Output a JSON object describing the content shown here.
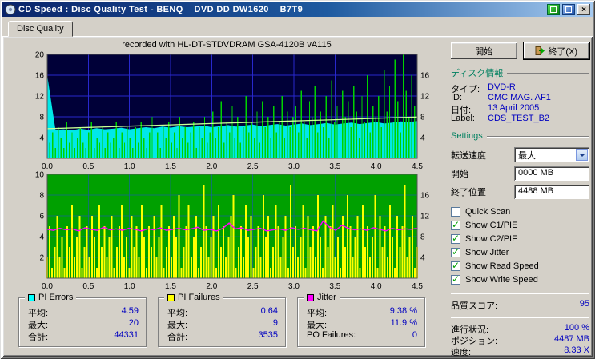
{
  "colors": {
    "window_bg": "#D4D0C8",
    "titlebar_start": "#0A246A",
    "titlebar_end": "#A6CAF0",
    "section_title": "#008060",
    "value_blue": "#0000C0",
    "check_green": "#00A000"
  },
  "window": {
    "title": "CD Speed : Disc Quality Test - BENQ    DVD DD DW1620    B7T9",
    "buttons": {
      "close": "×"
    }
  },
  "tab": {
    "label": "Disc Quality"
  },
  "graph_header": "recorded with HL-DT-STDVDRAM GSA-4120B vA115",
  "actions": {
    "start": "開始",
    "exit": "終了(X)"
  },
  "disc_info": {
    "title": "ディスク情報",
    "rows": [
      {
        "label": "タイプ:",
        "value": "DVD-R"
      },
      {
        "label": "ID:",
        "value": "CMC MAG. AF1"
      },
      {
        "label": "日付:",
        "value": "13 April 2005"
      },
      {
        "label": "Label:",
        "value": "CDS_TEST_B2"
      }
    ]
  },
  "settings": {
    "title": "Settings",
    "speed_label": "転送速度",
    "speed_value": "最大",
    "start_label": "開始",
    "start_value": "0000 MB",
    "end_label": "終了位置",
    "end_value": "4488 MB",
    "checkboxes": [
      {
        "label": "Quick Scan",
        "checked": false
      },
      {
        "label": "Show C1/PIE",
        "checked": true
      },
      {
        "label": "Show C2/PIF",
        "checked": true
      },
      {
        "label": "Show Jitter",
        "checked": true
      },
      {
        "label": "Show Read Speed",
        "checked": true
      },
      {
        "label": "Show Write Speed",
        "checked": true
      }
    ]
  },
  "quality": {
    "label": "品質スコア:",
    "value": "95"
  },
  "status": {
    "rows": [
      {
        "label": "進行状況:",
        "value": "100 %"
      },
      {
        "label": "ポジション:",
        "value": "4487 MB"
      },
      {
        "label": "速度:",
        "value": "8.33 X"
      }
    ]
  },
  "stats": {
    "boxes": [
      {
        "title": "PI Errors",
        "color": "#00FFFF",
        "rows": [
          {
            "label": "平均:",
            "value": "4.59"
          },
          {
            "label": "最大:",
            "value": "20"
          },
          {
            "label": "合計:",
            "value": "44331"
          }
        ]
      },
      {
        "title": "PI Failures",
        "color": "#FFFF00",
        "rows": [
          {
            "label": "平均:",
            "value": "0.64"
          },
          {
            "label": "最大:",
            "value": "9"
          },
          {
            "label": "合計:",
            "value": "3535"
          }
        ]
      },
      {
        "title": "Jitter",
        "color": "#FF00FF",
        "rows": [
          {
            "label": "平均:",
            "value": "9.38 %"
          },
          {
            "label": "最大:",
            "value": "11.9 %"
          },
          {
            "label": "PO Failures:",
            "value": "0"
          }
        ]
      }
    ]
  },
  "chart_data": [
    {
      "type": "area",
      "name": "pi-errors-graph",
      "bg": "#000038",
      "grid": "#2A2AD4",
      "grid_opacity": 0.95,
      "x_range": [
        0,
        4.5
      ],
      "x_ticks": [
        "0.0",
        "0.5",
        "1.0",
        "1.5",
        "2.0",
        "2.5",
        "3.0",
        "3.5",
        "4.0",
        "4.5"
      ],
      "left_max": 20,
      "left_ticks": [
        20,
        16,
        12,
        8,
        4
      ],
      "right_max": 20,
      "right_ticks": [
        16,
        12,
        8,
        4
      ],
      "series": [
        {
          "name": "read-speed-area",
          "draw": "area",
          "color": "#00E8E8",
          "max": 20,
          "values": [
            16,
            5.5,
            5.6,
            5.4,
            5.7,
            5.5,
            5.8,
            5.6,
            5.7,
            5.9,
            5.6,
            5.8,
            6.0,
            5.8,
            6.1,
            5.9,
            6.2,
            6.0,
            6.1,
            6.3,
            6.0,
            6.2,
            6.4,
            6.1,
            6.3,
            6.5,
            6.2,
            6.4,
            6.6,
            6.3,
            6.5,
            6.7,
            6.4,
            6.6,
            6.8,
            6.5,
            6.7,
            6.9,
            6.6,
            6.8,
            7.0,
            6.7,
            6.9,
            7.1,
            7.0,
            7.2
          ]
        },
        {
          "name": "pi-errors-spikes",
          "draw": "spikes",
          "color": "#00D200",
          "max": 20,
          "width": 1.4,
          "values": [
            16,
            3,
            5,
            2,
            6,
            4,
            2,
            7,
            3,
            5,
            2,
            4,
            6,
            3,
            2,
            5,
            7,
            2,
            4,
            3,
            6,
            2,
            5,
            3,
            4,
            7,
            2,
            5,
            3,
            6,
            4,
            2,
            6,
            3,
            7,
            4,
            2,
            5,
            8,
            3,
            5,
            2,
            6,
            4,
            7,
            3,
            5,
            2,
            8,
            4,
            6,
            3,
            5,
            7,
            2,
            6,
            4,
            8,
            3,
            5,
            9,
            4,
            6,
            11,
            3,
            7,
            5,
            10,
            4,
            8,
            3,
            6,
            12,
            5,
            7,
            4,
            9,
            3,
            11,
            6,
            8,
            4,
            10,
            5,
            7,
            12,
            4,
            9,
            6,
            8,
            10,
            5,
            13,
            7,
            4,
            11,
            8,
            14,
            5,
            9,
            6,
            12,
            4,
            15,
            7,
            10,
            5,
            13,
            8,
            11,
            6,
            14,
            9,
            4,
            12,
            7,
            16,
            5,
            10,
            8,
            12,
            6,
            17,
            9,
            14,
            7,
            19,
            11,
            5,
            20,
            13,
            8,
            16,
            10,
            12
          ]
        },
        {
          "name": "write-speed-line",
          "draw": "line",
          "color": "#C8FF96",
          "max": 20,
          "width": 1.3,
          "values": [
            5.7,
            5.95,
            6.2,
            6.45,
            6.7,
            6.95,
            7.2,
            7.45,
            7.7,
            7.95
          ]
        }
      ]
    },
    {
      "type": "bar",
      "name": "pi-failures-jitter-graph",
      "bg": "#00A000",
      "grid": "#1E50C8",
      "grid_opacity": 0.55,
      "x_range": [
        0,
        4.5
      ],
      "x_ticks": [
        "0.0",
        "0.5",
        "1.0",
        "1.5",
        "2.0",
        "2.5",
        "3.0",
        "3.5",
        "4.0",
        "4.5"
      ],
      "left_max": 10,
      "left_ticks": [
        10,
        8,
        6,
        4,
        2
      ],
      "right_max": 20,
      "right_ticks": [
        16,
        12,
        8,
        4
      ],
      "series": [
        {
          "name": "pi-failures-spikes",
          "draw": "spikes",
          "color": "#FFFF00",
          "max": 10,
          "width": 2,
          "values": [
            2,
            5,
            1,
            3,
            6,
            2,
            4,
            1,
            5,
            3,
            7,
            2,
            4,
            6,
            1,
            3,
            5,
            2,
            6,
            4,
            1,
            7,
            3,
            5,
            2,
            4,
            6,
            1,
            3,
            5,
            7,
            2,
            4,
            1,
            6,
            3,
            5,
            2,
            7,
            4,
            1,
            5,
            3,
            6,
            2,
            4,
            7,
            1,
            3,
            5,
            2,
            6,
            4,
            8,
            1,
            3,
            5,
            7,
            2,
            4,
            6,
            1,
            3,
            9,
            5,
            2,
            4,
            6,
            1,
            7,
            3,
            5,
            2,
            4,
            6,
            8,
            1,
            3,
            5,
            2,
            7,
            4,
            6,
            1,
            3,
            5,
            2,
            8,
            4,
            6,
            1,
            3,
            7,
            5,
            2,
            4,
            6,
            1,
            9,
            3,
            5,
            2,
            4,
            7,
            1,
            6,
            3,
            5,
            2,
            8,
            4,
            1,
            6,
            3,
            5,
            7,
            2,
            4,
            1,
            6,
            3,
            8,
            5,
            2,
            4,
            6,
            1,
            7,
            3,
            5,
            2,
            4,
            8,
            1,
            6,
            3,
            5,
            2,
            7,
            4,
            1,
            6,
            3,
            5,
            9,
            2,
            4,
            6,
            1,
            3
          ]
        },
        {
          "name": "jitter-line",
          "draw": "line",
          "color": "#FF00FF",
          "max": 20,
          "width": 1.4,
          "values": [
            9.4,
            9.2,
            9.6,
            9.3,
            9.5,
            9.1,
            9.7,
            9.4,
            9.2,
            9.8,
            9.3,
            9.5,
            9.2,
            9.6,
            9.4,
            9.1,
            9.5,
            9.3,
            9.7,
            9.2,
            9.4,
            9.6,
            9.3,
            9.5,
            9.8,
            9.2,
            9.4,
            9.1,
            9.6,
            10.6,
            9.5,
            9.7,
            9.2,
            9.4,
            9.6,
            9.1,
            9.3,
            9.5,
            9.2,
            9.7,
            9.4,
            9.6,
            9.3,
            9.1,
            11.0,
            9.8,
            9.2,
            10.2,
            9.6,
            9.3,
            9.5,
            9.2,
            9.7,
            9.4,
            9.1,
            9.6,
            9.3,
            9.5,
            9.4,
            9.6
          ]
        }
      ]
    }
  ]
}
